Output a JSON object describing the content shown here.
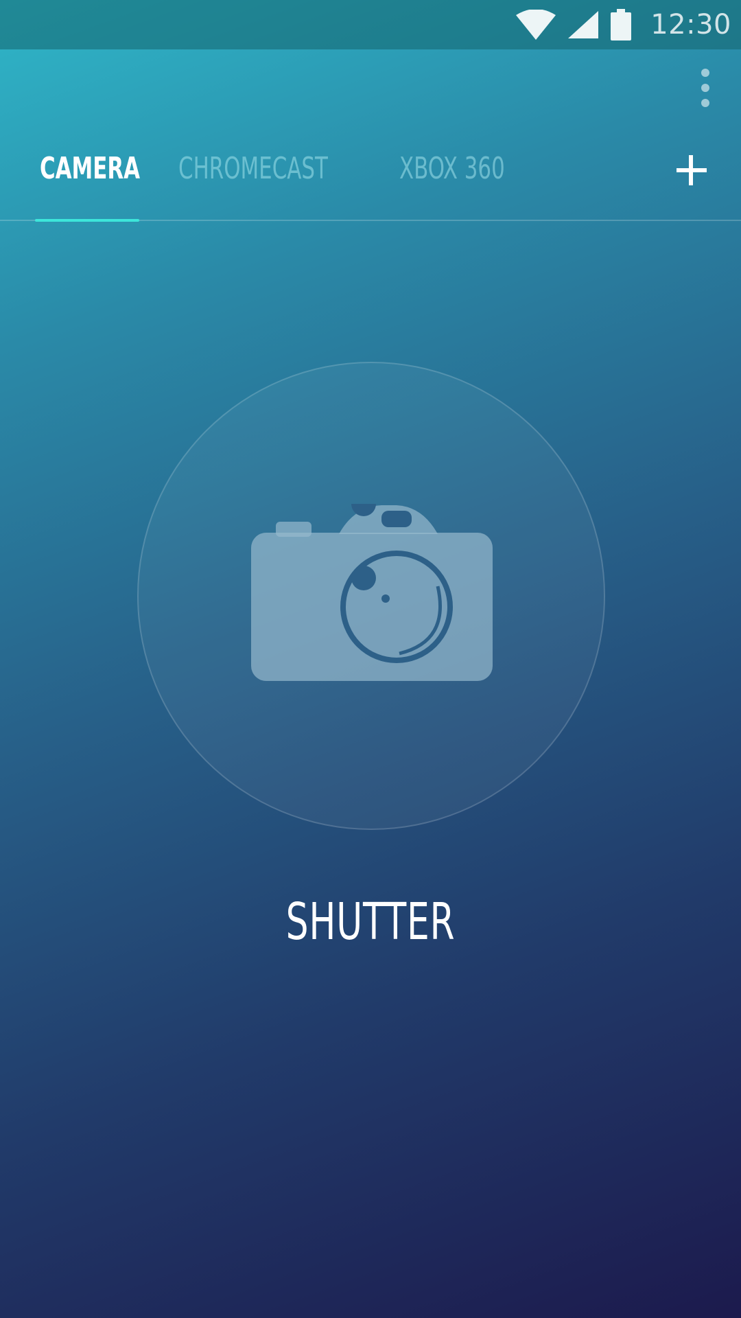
{
  "status_bar": {
    "time": "12:30",
    "icons": [
      "wifi-icon",
      "signal-icon",
      "battery-icon"
    ]
  },
  "toolbar": {
    "overflow_icon": "more-vert-icon"
  },
  "tabs": [
    {
      "label": "CAMERA",
      "active": true
    },
    {
      "label": "CHROMECAST",
      "active": false
    },
    {
      "label": "XBOX 360",
      "active": false
    }
  ],
  "add_tab_icon": "plus-icon",
  "main": {
    "shutter_icon": "camera-icon",
    "shutter_label": "SHUTTER"
  },
  "colors": {
    "accent": "#3de6da",
    "gradient_top": "#2fb6c8",
    "gradient_bottom": "#1c1a4d"
  }
}
